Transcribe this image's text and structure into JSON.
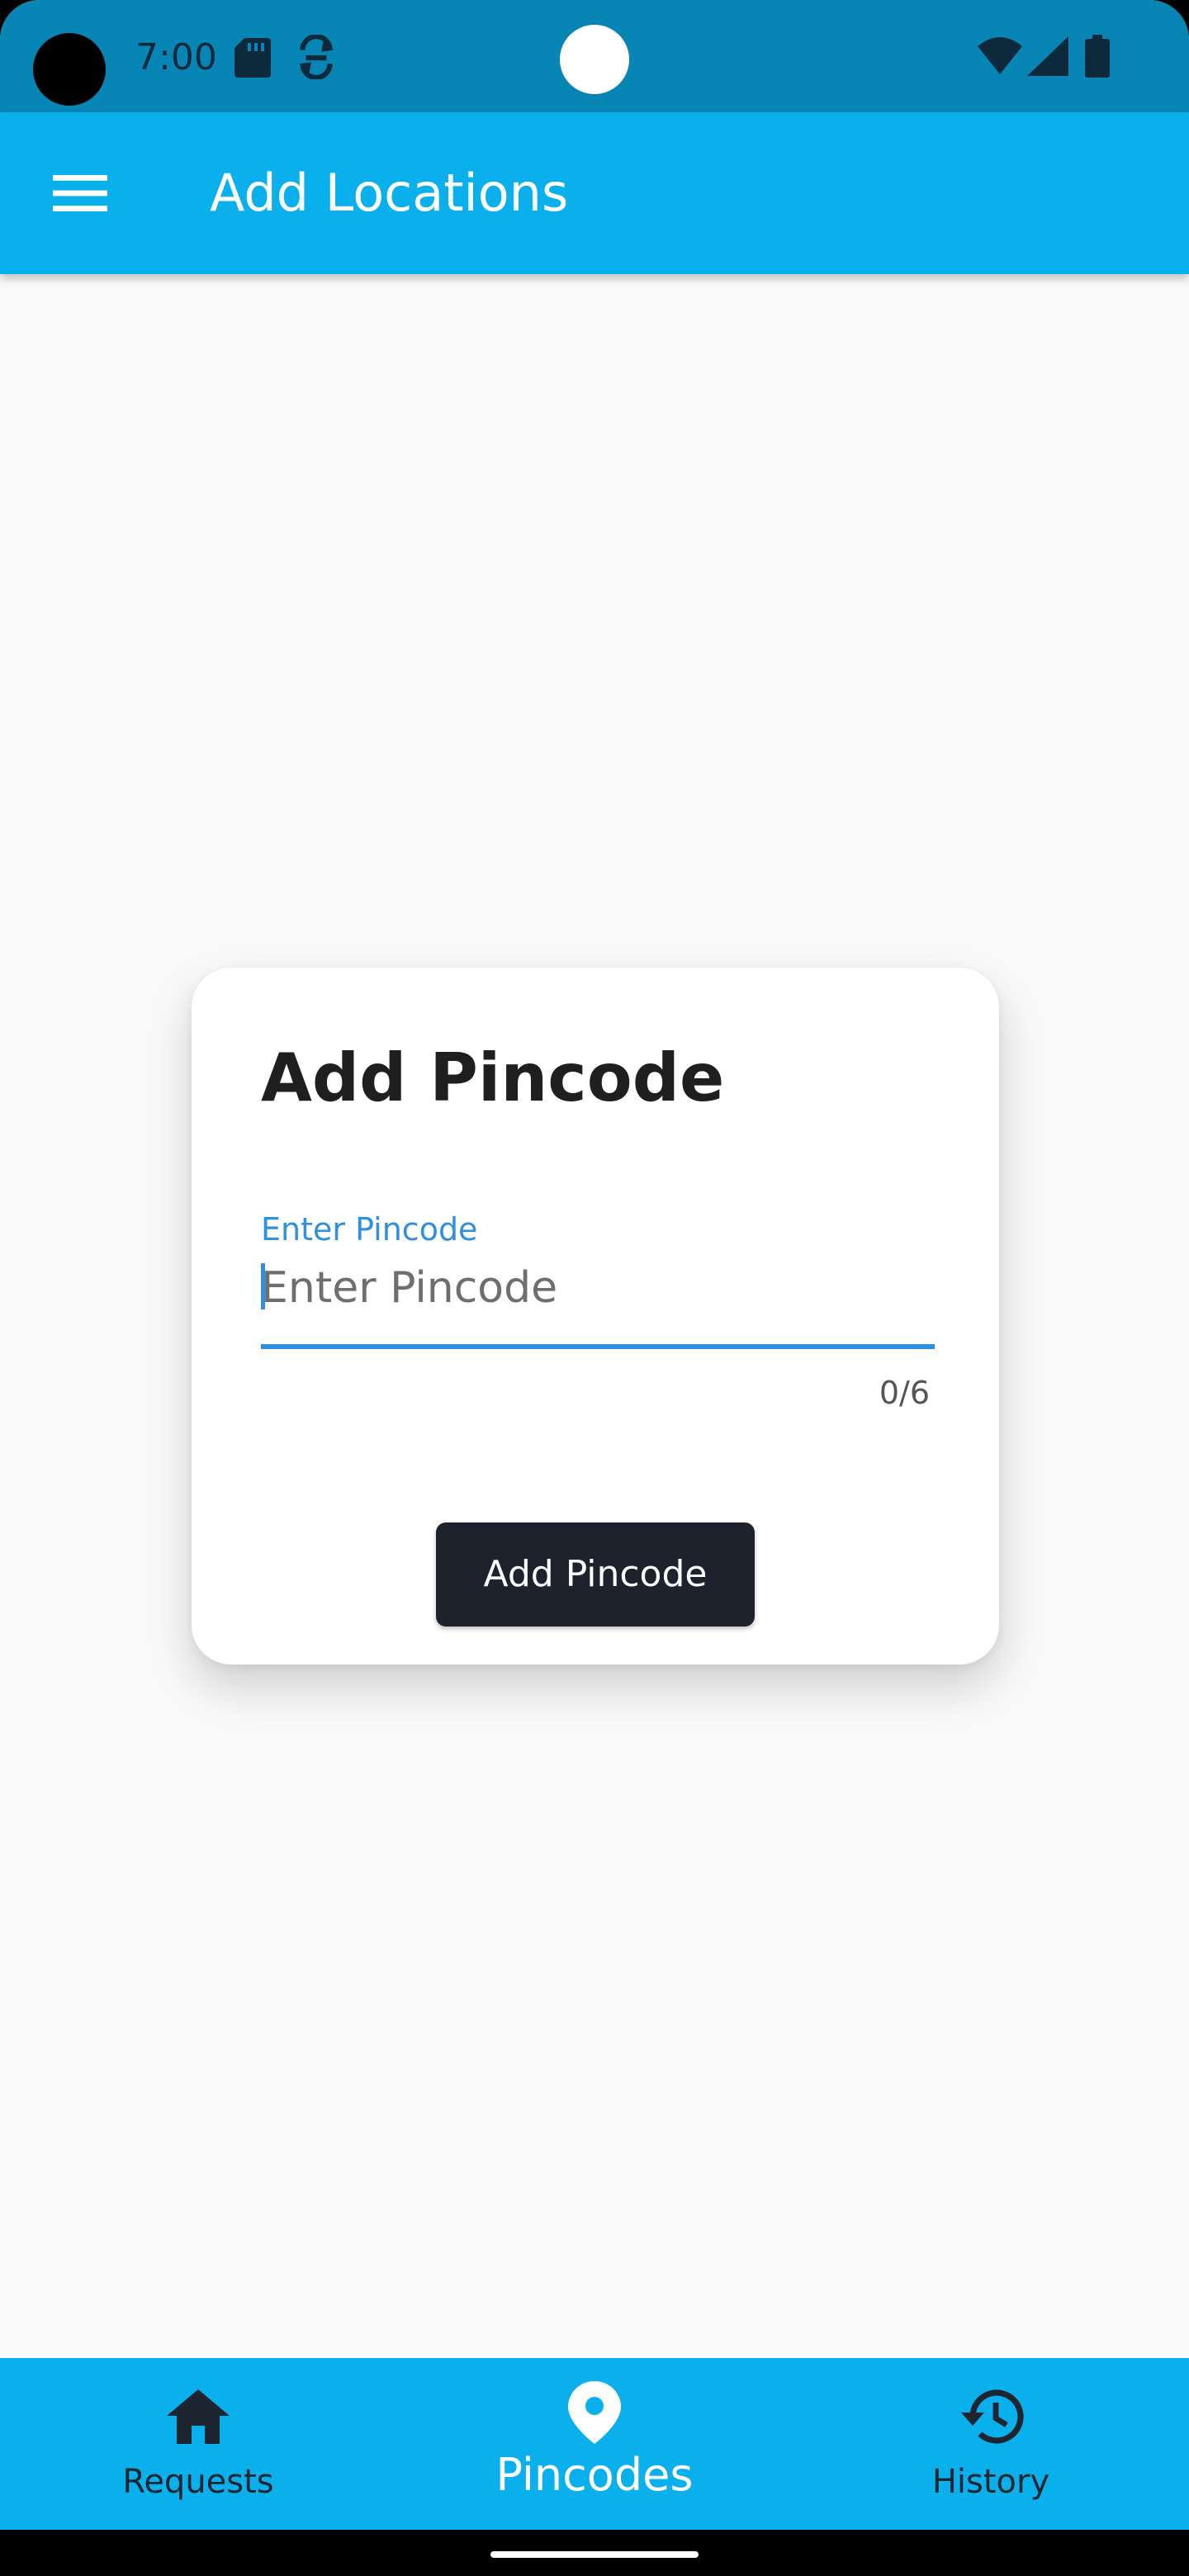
{
  "status_bar": {
    "time": "7:00",
    "icons": [
      "sd-card-icon",
      "sync-icon",
      "wifi-icon",
      "cell-signal-icon",
      "battery-icon"
    ]
  },
  "app_bar": {
    "title": "Add Locations",
    "menu_icon": "hamburger-menu-icon",
    "background": "#09b0ec"
  },
  "card": {
    "title": "Add Pincode",
    "field": {
      "label": "Enter Pincode",
      "placeholder": "Enter Pincode",
      "value": "",
      "counter": "0/6",
      "accent": "#2f8fe0"
    },
    "button_label": "Add Pincode",
    "button_color": "#1e222c"
  },
  "bottom_nav": {
    "items": [
      {
        "label": "Requests",
        "icon": "home-icon",
        "active": false
      },
      {
        "label": "Pincodes",
        "icon": "location-pin-icon",
        "active": true
      },
      {
        "label": "History",
        "icon": "history-icon",
        "active": false
      }
    ],
    "background": "#09b0ec"
  }
}
